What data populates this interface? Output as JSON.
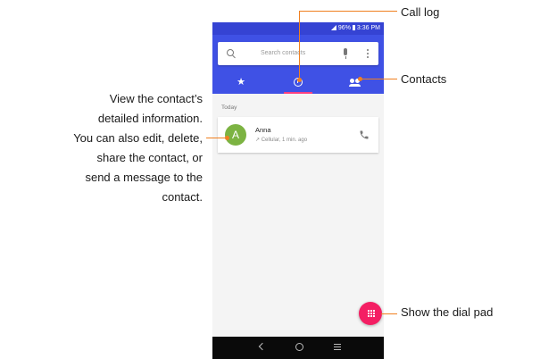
{
  "status_bar": {
    "battery": "96%",
    "time": "3:36 PM"
  },
  "search": {
    "placeholder": "Search contacts",
    "icon": "search-icon"
  },
  "tabs": [
    {
      "name": "favorites",
      "icon": "star-icon"
    },
    {
      "name": "call-log",
      "icon": "clock-icon",
      "selected": true
    },
    {
      "name": "contacts",
      "icon": "people-icon"
    }
  ],
  "call_log": {
    "section_label": "Today",
    "entries": [
      {
        "initial": "A",
        "name": "Anna",
        "detail": "↗ Cellular, 1 min. ago",
        "avatar_color": "#7cb342"
      }
    ]
  },
  "callouts": {
    "call_log": "Call log",
    "contacts": "Contacts",
    "dial_pad": "Show the dial pad",
    "detail_lines": [
      "View the contact’s",
      "detailed information.",
      "You can also edit, delete,",
      "share the contact, or",
      "send a message to the",
      "contact."
    ]
  },
  "colors": {
    "app_bar": "#3f51e5",
    "status_bar": "#3543d3",
    "accent": "#ff4081",
    "fab": "#f41e63",
    "leader_line": "#f08020"
  }
}
